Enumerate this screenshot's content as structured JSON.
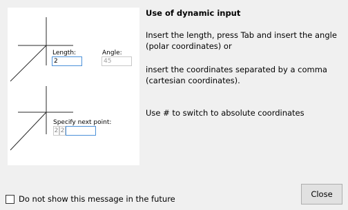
{
  "illustration": {
    "top_example": {
      "length_label": "Length:",
      "length_value": "2",
      "angle_label": "Angle:",
      "angle_value": "45"
    },
    "bottom_example": {
      "prompt_label": "Specify next point:",
      "cell_1": "2",
      "cell_2": "2"
    }
  },
  "content": {
    "heading": "Use of dynamic input",
    "paragraph_1": "Insert the length, press Tab and insert the angle (polar coordinates) or",
    "paragraph_2": "insert the coordinates separated by a comma (cartesian coordinates).",
    "paragraph_3": "Use # to switch to absolute coordinates"
  },
  "footer": {
    "checkbox_label": "Do not show this message in the future",
    "checkbox_checked": false,
    "close_label": "Close"
  }
}
